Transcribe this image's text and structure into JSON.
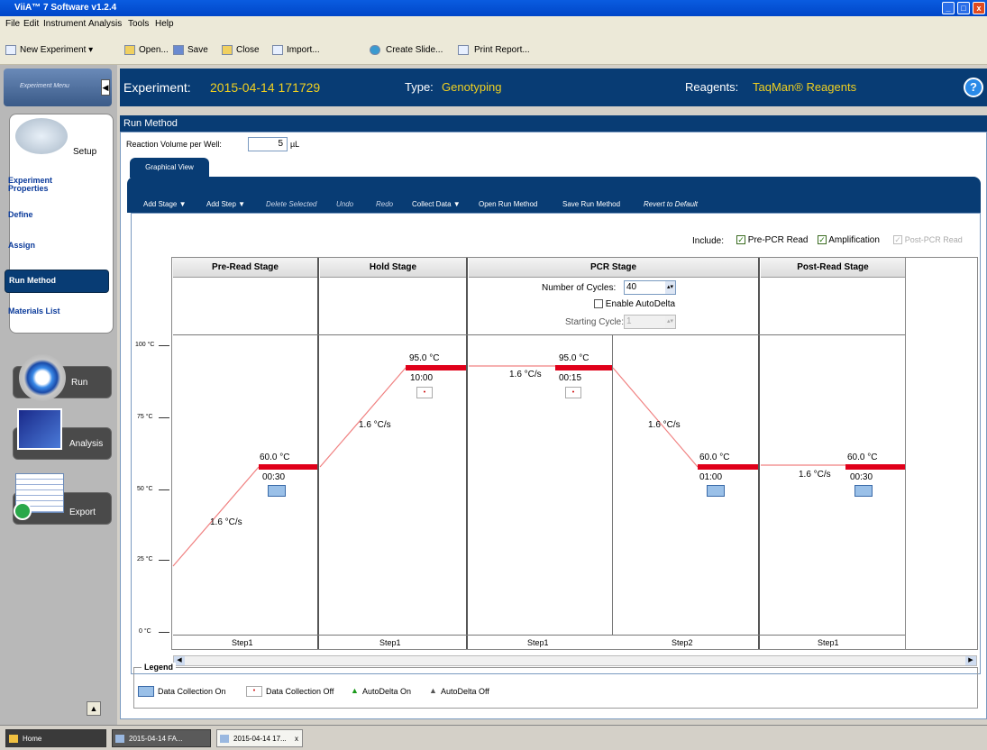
{
  "window": {
    "title": "ViiA™ 7 Software v1.2.4"
  },
  "menu": [
    "File",
    "Edit",
    "Instrument",
    "Analysis",
    "Tools",
    "Help"
  ],
  "toolbar": {
    "new_experiment": "New Experiment",
    "open": "Open...",
    "save": "Save",
    "close": "Close",
    "import": "Import...",
    "create_slide": "Create Slide...",
    "print_report": "Print Report..."
  },
  "sidebar": {
    "menu_label": "Experiment Menu",
    "setup": "Setup",
    "items": [
      "Experiment Properties",
      "Define",
      "Assign",
      "Run Method",
      "Materials List"
    ],
    "selected": "Run Method",
    "run": "Run",
    "analysis": "Analysis",
    "export": "Export",
    "scroll_up": "▲"
  },
  "header": {
    "experiment_label": "Experiment:",
    "experiment_value": "2015-04-14 171729",
    "type_label": "Type:",
    "type_value": "Genotyping",
    "reagents_label": "Reagents:",
    "reagents_value": "TaqMan® Reagents",
    "help": "?"
  },
  "run_method": {
    "title": "Run Method",
    "volume_label": "Reaction Volume per Well:",
    "volume_value": "5",
    "volume_unit": "µL",
    "tab": "Graphical View"
  },
  "actions": {
    "add_stage": "Add Stage ▼",
    "add_step": "Add Step ▼",
    "delete_selected": "Delete Selected",
    "undo": "Undo",
    "redo": "Redo",
    "collect_data": "Collect Data ▼",
    "open_run_method": "Open Run Method",
    "save_run_method": "Save Run Method",
    "revert_default": "Revert to Default"
  },
  "include": {
    "label": "Include:",
    "pre_pcr": "Pre-PCR Read",
    "amplification": "Amplification",
    "post_pcr": "Post-PCR Read"
  },
  "y_ticks": [
    "100 °C",
    "75 °C",
    "50 °C",
    "25 °C",
    "0 °C"
  ],
  "stages": {
    "pre_read": "Pre-Read Stage",
    "hold": "Hold Stage",
    "pcr": "PCR Stage",
    "post_read": "Post-Read Stage"
  },
  "pcr_settings": {
    "cycles_label": "Number of Cycles:",
    "cycles_value": "40",
    "autodelta": "Enable AutoDelta",
    "start_label": "Starting Cycle:",
    "start_value": "1"
  },
  "steps": {
    "pre_temp": "60.0 °C",
    "pre_time": "00:30",
    "pre_rate": "1.6 °C/s",
    "pre_step": "Step1",
    "hold_temp": "95.0 °C",
    "hold_time": "10:00",
    "hold_rate": "1.6 °C/s",
    "hold_step": "Step1",
    "pcr1_temp": "95.0 °C",
    "pcr1_time": "00:15",
    "pcr1_rate": "1.6 °C/s",
    "pcr1_step": "Step1",
    "pcr2_temp": "60.0 °C",
    "pcr2_time": "01:00",
    "pcr2_rate": "1.6 °C/s",
    "pcr2_step": "Step2",
    "post_temp": "60.0 °C",
    "post_time": "00:30",
    "post_rate": "1.6 °C/s",
    "post_step": "Step1"
  },
  "legend": {
    "title": "Legend",
    "dc_on": "Data Collection On",
    "dc_off": "Data Collection Off",
    "ad_on": "AutoDelta On",
    "ad_off": "AutoDelta Off"
  },
  "taskbar": {
    "home": "Home",
    "tab1": "2015-04-14 FA...",
    "tab2": "2015-04-14 17...",
    "close_x": "x"
  },
  "colors": {
    "navy": "#083c74",
    "accent_yellow": "#f0d020",
    "hold_red": "#e0001a"
  }
}
